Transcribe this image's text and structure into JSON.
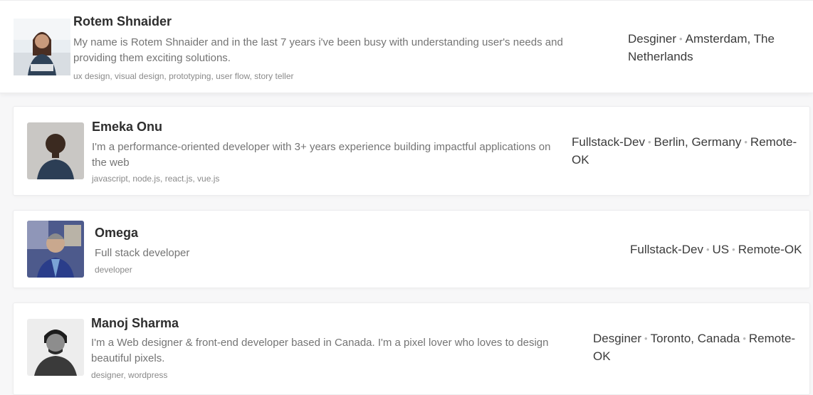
{
  "profiles": [
    {
      "name": "Rotem Shnaider",
      "bio": "My name is Rotem Shnaider and in the last 7 years i've been busy with understanding user's needs and providing them exciting solutions.",
      "tags": "ux design, visual design, prototyping, user flow, story teller",
      "role": "Desginer",
      "location": "Amsterdam, The Netherlands",
      "remote": "",
      "avatar_icon": "person-portrait-icon"
    },
    {
      "name": "Emeka Onu",
      "bio": "I'm a performance-oriented developer with 3+ years experience building impactful applications on the web",
      "tags": "javascript, node.js, react.js, vue.js",
      "role": "Fullstack-Dev",
      "location": "Berlin, Germany",
      "remote": "Remote-OK",
      "avatar_icon": "person-portrait-icon"
    },
    {
      "name": "Omega",
      "bio": "Full stack developer",
      "tags": "developer",
      "role": "Fullstack-Dev",
      "location": "US",
      "remote": "Remote-OK",
      "avatar_icon": "person-portrait-icon"
    },
    {
      "name": "Manoj Sharma",
      "bio": "I'm a Web designer & front-end developer based in Canada. I'm a pixel lover who loves to design beautiful pixels.",
      "tags": "designer, wordpress",
      "role": "Desginer",
      "location": "Toronto, Canada",
      "remote": "Remote-OK",
      "avatar_icon": "person-portrait-icon"
    }
  ],
  "colors": {
    "card_bg": "#ffffff",
    "page_bg": "#f7f7f8",
    "name": "#2e2e2e",
    "bio": "#747474",
    "tags": "#8a8a8a",
    "meta": "#3b3b3b",
    "separator_dot": "#b9b9b9"
  }
}
